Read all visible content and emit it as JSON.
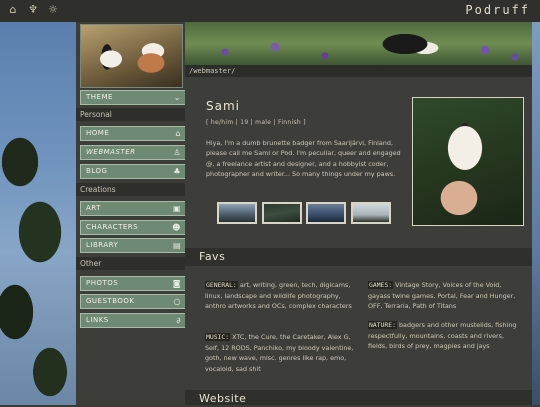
{
  "topbar": {
    "icons": [
      "home-icon",
      "tooth-icon",
      "sun-icon"
    ],
    "brand": "Podruff"
  },
  "sidebar": {
    "theme_label": "THEME",
    "sections": {
      "personal": "Personal",
      "creations": "Creations",
      "other": "Other"
    },
    "items": [
      {
        "label": "HOME",
        "icon": "house-icon"
      },
      {
        "label": "WEBMASTER",
        "icon": "person-icon"
      },
      {
        "label": "BLOG",
        "icon": "plant-icon"
      },
      {
        "label": "ART",
        "icon": "image-icon"
      },
      {
        "label": "CHARACTERS",
        "icon": "people-icon"
      },
      {
        "label": "LIBRARY",
        "icon": "book-icon"
      },
      {
        "label": "PHOTOS",
        "icon": "camera-icon"
      },
      {
        "label": "GUESTBOOK",
        "icon": "chat-icon"
      },
      {
        "label": "LINKS",
        "icon": "paperclip-icon"
      }
    ]
  },
  "main": {
    "path": "/webmaster/",
    "name": "Sami",
    "meta": "[ he/him | 19 | male | Finnish ]",
    "bio": "Hiya, I'm a dumb brunette badger from Saarijärvi, Finland, please call me Sami or Pod. I'm peculiar, queer and engaged @, a freelance artist and designer, and a hobbyist coder, photographer and writer... So many things under my paws.",
    "favs_heading": "Favs",
    "favs": {
      "general_tag": "GENERAL:",
      "general_text": "art, writing, green, tech, digicams, linux, landscape and wildlife photography, anthro artworks and OCs, complex characters",
      "music_tag": "MUSIC:",
      "music_text": "XTC, the Cure, the Caretaker, Alex G, Self, 12 RODS, Panchiko, my bloody valentine, goth, new wave, misc. genres like rap, emo, vocaloid, sad shit",
      "games_tag": "GAMES:",
      "games_text": "Vintage Story, Voices of the Void, gayass twine games, Portal, Fear and Hunger, OFF, Terraria, Path of Titans",
      "nature_tag": "NATURE:",
      "nature_text": "badgers and other mustelids, fishing respectfully, mountains, coasts and rivers, fields, birds of prey, magpies and jays"
    },
    "website_heading": "Website"
  }
}
